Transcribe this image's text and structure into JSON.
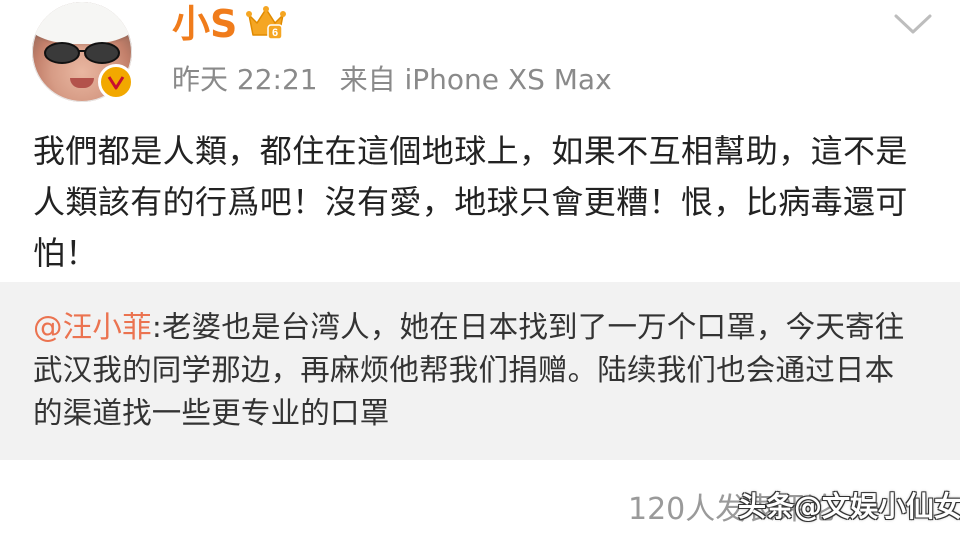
{
  "header": {
    "username": "小S",
    "time": "昨天 22:21",
    "source": "来自 iPhone XS Max",
    "badge_level": "6"
  },
  "post": {
    "text": "我們都是人類，都住在這個地球上，如果不互相幫助，這不是人類該有的行爲吧！沒有愛，地球只會更糟！恨，比病毒還可怕！"
  },
  "retweet": {
    "mention": "@汪小菲",
    "text": ":老婆也是台湾人，她在日本找到了一万个口罩，今天寄往武汉我的同学那边，再麻烦他帮我们捐赠。陆续我们也会通过日本的渠道找一些更专业的口罩"
  },
  "footer": {
    "forward_count": "120人发表评论",
    "watermark": "头条@文娱小仙女"
  },
  "icons": {
    "crown": "crown-icon",
    "verified": "verified-icon",
    "menu": "chevron-down-icon"
  },
  "colors": {
    "username": "#f07c1b",
    "mention": "#eb7350",
    "badge": "#f2a800",
    "retweet_bg": "#f2f2f2"
  }
}
